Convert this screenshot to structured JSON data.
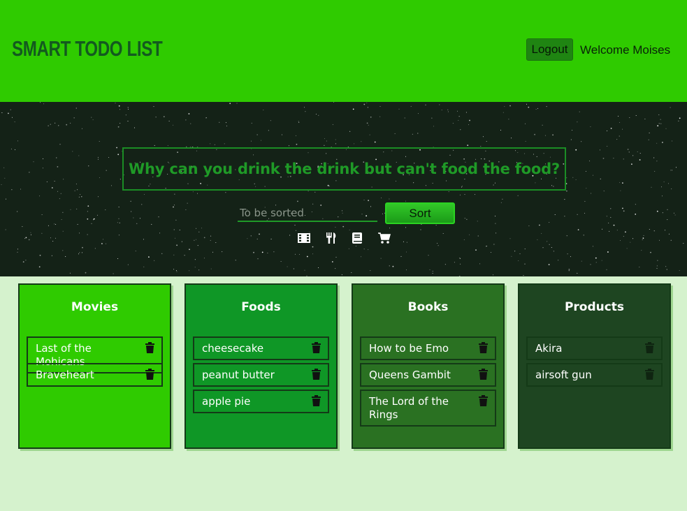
{
  "header": {
    "brand": "SMART TODO LIST",
    "logout_label": "Logout",
    "welcome_text": "Welcome Moises"
  },
  "hero": {
    "quote": "Why can you drink the drink but can't food the food?",
    "input_placeholder": "To be sorted",
    "sort_label": "Sort",
    "category_icons": [
      "film-icon",
      "utensils-icon",
      "book-icon",
      "shopping-cart-icon"
    ]
  },
  "columns": [
    {
      "title": "Movies",
      "color": "#2fcb00",
      "items": [
        "Last of the Mohicans",
        "Braveheart"
      ]
    },
    {
      "title": "Foods",
      "color": "#0f9726",
      "items": [
        "cheesecake",
        "peanut butter",
        "apple pie"
      ]
    },
    {
      "title": "Books",
      "color": "#2a7122",
      "items": [
        "How to be Emo",
        "Queens Gambit",
        "The Lord of the Rings"
      ]
    },
    {
      "title": "Products",
      "color": "#1e4521",
      "items": [
        "Akira",
        "airsoft gun"
      ]
    }
  ],
  "colors": {
    "header_bg": "#2fcb00",
    "hero_bg": "#142217",
    "page_bg": "#d5f2cd",
    "accent": "#1f9a27"
  }
}
